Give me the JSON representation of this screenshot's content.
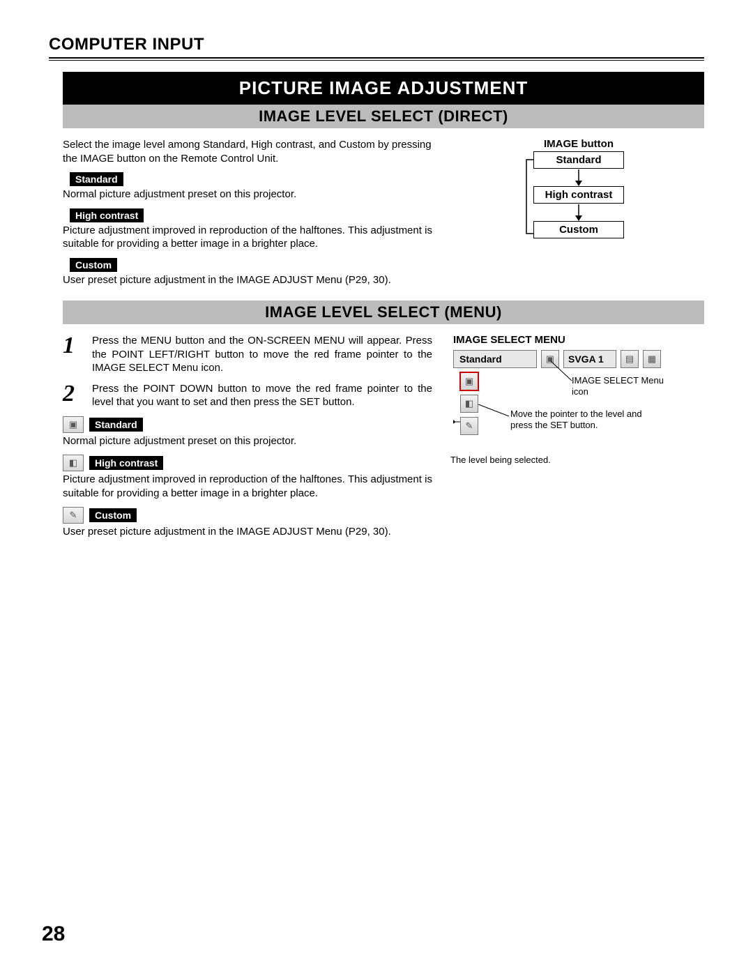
{
  "header": {
    "title": "COMPUTER INPUT"
  },
  "chapter": "PICTURE IMAGE ADJUSTMENT",
  "section_direct": {
    "title": "IMAGE LEVEL SELECT (DIRECT)",
    "intro": "Select the image level among Standard, High contrast, and Custom by pressing the IMAGE button on the Remote Control Unit.",
    "items": [
      {
        "label": "Standard",
        "desc": "Normal picture adjustment preset on this projector."
      },
      {
        "label": "High contrast",
        "desc": "Picture adjustment improved in reproduction of the halftones.  This adjustment is suitable for providing a better image in a brighter place."
      },
      {
        "label": "Custom",
        "desc": "User preset picture adjustment in the IMAGE ADJUST Menu (P29, 30)."
      }
    ],
    "flow_title": "IMAGE button",
    "flow_steps": [
      "Standard",
      "High contrast",
      "Custom"
    ]
  },
  "section_menu": {
    "title": "IMAGE LEVEL SELECT (MENU)",
    "steps": [
      "Press the MENU button and the ON-SCREEN MENU will appear.  Press the POINT LEFT/RIGHT button to move the red frame pointer to the IMAGE SELECT Menu icon.",
      "Press the POINT DOWN button to move the red frame pointer to the level that you want to set and then press the SET button."
    ],
    "items": [
      {
        "label": "Standard",
        "desc": "Normal picture adjustment preset on this projector."
      },
      {
        "label": "High contrast",
        "desc": "Picture adjustment improved in reproduction of the halftones.  This adjustment is suitable for providing a better image in a brighter place."
      },
      {
        "label": "Custom",
        "desc": "User preset picture adjustment in the IMAGE ADJUST Menu (P29, 30)."
      }
    ],
    "osd": {
      "title": "IMAGE SELECT MENU",
      "mode": "Standard",
      "resolution": "SVGA 1",
      "callout_icon": "IMAGE SELECT Menu icon",
      "callout_pointer": "Move the pointer to the level and press the SET button.",
      "callout_select": "The level being selected."
    }
  },
  "page_number": "28"
}
